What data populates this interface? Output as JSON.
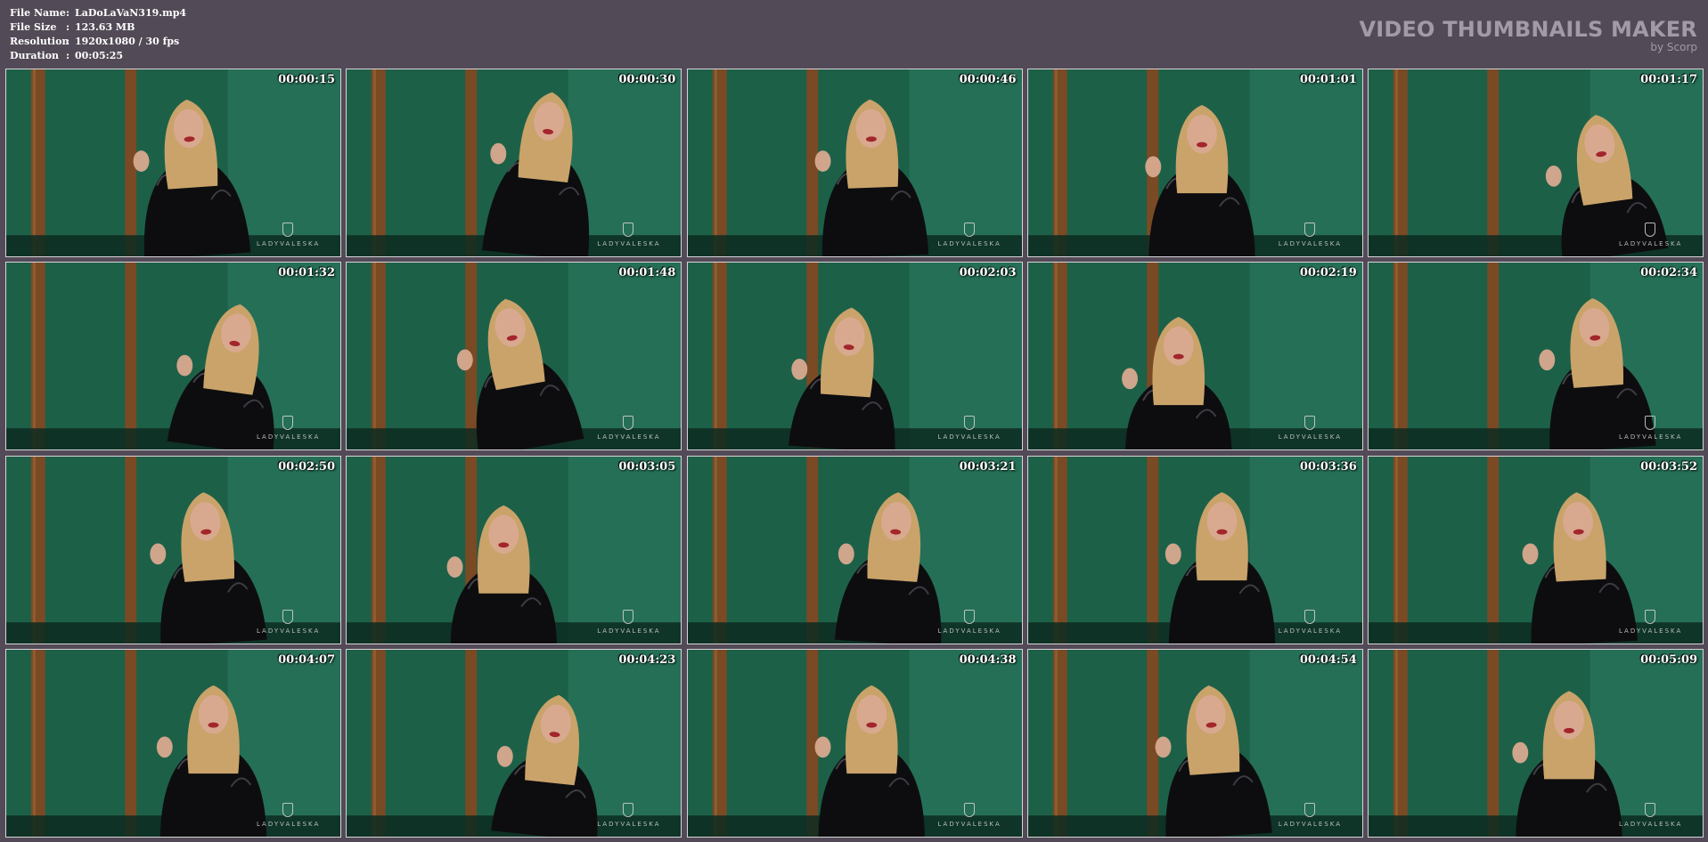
{
  "file_info": {
    "rows": [
      {
        "label": "File Name",
        "sep": ":",
        "value": "LaDoLaVaN319.mp4"
      },
      {
        "label": "File Size",
        "sep": ":",
        "value": "123.63 MB"
      },
      {
        "label": "Resolution",
        "sep": ":",
        "value": "1920x1080 / 30 fps"
      },
      {
        "label": "Duration",
        "sep": ":",
        "value": "00:05:25"
      }
    ]
  },
  "brand": {
    "title": "VIDEO THUMBNAILS MAKER",
    "subtitle": "by Scorp"
  },
  "thumbnails": [
    {
      "timestamp": "00:00:15",
      "watermark": "LADYVALESKA"
    },
    {
      "timestamp": "00:00:30",
      "watermark": "LADYVALESKA"
    },
    {
      "timestamp": "00:00:46",
      "watermark": "LADYVALESKA"
    },
    {
      "timestamp": "00:01:01",
      "watermark": "LADYVALESKA"
    },
    {
      "timestamp": "00:01:17",
      "watermark": "LADYVALESKA"
    },
    {
      "timestamp": "00:01:32",
      "watermark": "LADYVALESKA"
    },
    {
      "timestamp": "00:01:48",
      "watermark": "LADYVALESKA"
    },
    {
      "timestamp": "00:02:03",
      "watermark": "LADYVALESKA"
    },
    {
      "timestamp": "00:02:19",
      "watermark": "LADYVALESKA"
    },
    {
      "timestamp": "00:02:34",
      "watermark": "LADYVALESKA"
    },
    {
      "timestamp": "00:02:50",
      "watermark": "LADYVALESKA"
    },
    {
      "timestamp": "00:03:05",
      "watermark": "LADYVALESKA"
    },
    {
      "timestamp": "00:03:21",
      "watermark": "LADYVALESKA"
    },
    {
      "timestamp": "00:03:36",
      "watermark": "LADYVALESKA"
    },
    {
      "timestamp": "00:03:52",
      "watermark": "LADYVALESKA"
    },
    {
      "timestamp": "00:04:07",
      "watermark": "LADYVALESKA"
    },
    {
      "timestamp": "00:04:23",
      "watermark": "LADYVALESKA"
    },
    {
      "timestamp": "00:04:38",
      "watermark": "LADYVALESKA"
    },
    {
      "timestamp": "00:04:54",
      "watermark": "LADYVALESKA"
    },
    {
      "timestamp": "00:05:09",
      "watermark": "LADYVALESKA"
    }
  ],
  "colors": {
    "background": "#524a56",
    "brand_text": "#a29aa6",
    "wall_green": "#1d6048",
    "wood_post": "#7a4a24",
    "latex": "#0d0d0f",
    "hair": "#c9a36a",
    "skin": "#d9a98f"
  }
}
